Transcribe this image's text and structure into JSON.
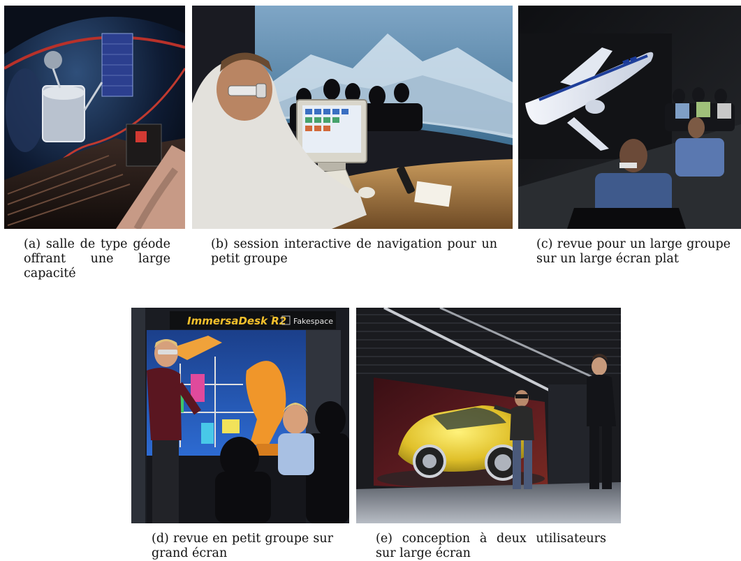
{
  "figures": [
    {
      "id": "a",
      "caption": "(a) salle de type géode offrant une large capacité"
    },
    {
      "id": "b",
      "caption": "(b) session interactive de navigation pour un petit groupe"
    },
    {
      "id": "c",
      "caption": "(c) revue pour un large groupe sur un large écran plat"
    },
    {
      "id": "d",
      "caption": "(d) revue en petit groupe sur grand écran",
      "sign_brand": "ImmersaDesk R2",
      "sign_trademark": "™",
      "sign_maker": "Fakespace"
    },
    {
      "id": "e",
      "caption": "(e) conception à deux utilisateurs sur large écran"
    }
  ]
}
